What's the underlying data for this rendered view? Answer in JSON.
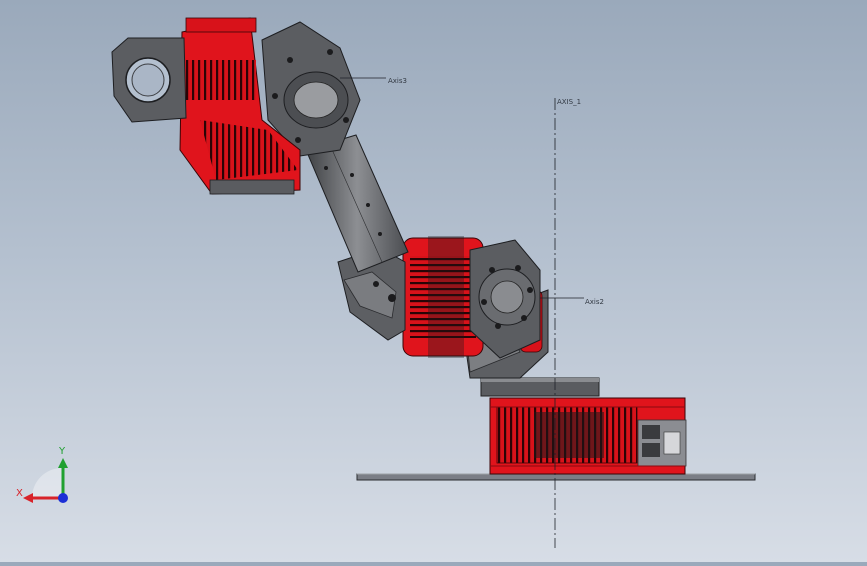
{
  "scene": {
    "axis_labels": {
      "axis1": "AXIS_1",
      "axis2": "Axis2",
      "axis3": "Axis3"
    },
    "triad": {
      "x_label": "X",
      "y_label": "Y",
      "x_color": "#d8232a",
      "y_color": "#20a030",
      "z_color": "#1c2fd6"
    },
    "colors": {
      "motor_red": "#e0141c",
      "motor_dark": "#5a0a0c",
      "body_gray": "#595b5f",
      "body_light": "#8a8c90",
      "plate": "#7d8088"
    }
  }
}
